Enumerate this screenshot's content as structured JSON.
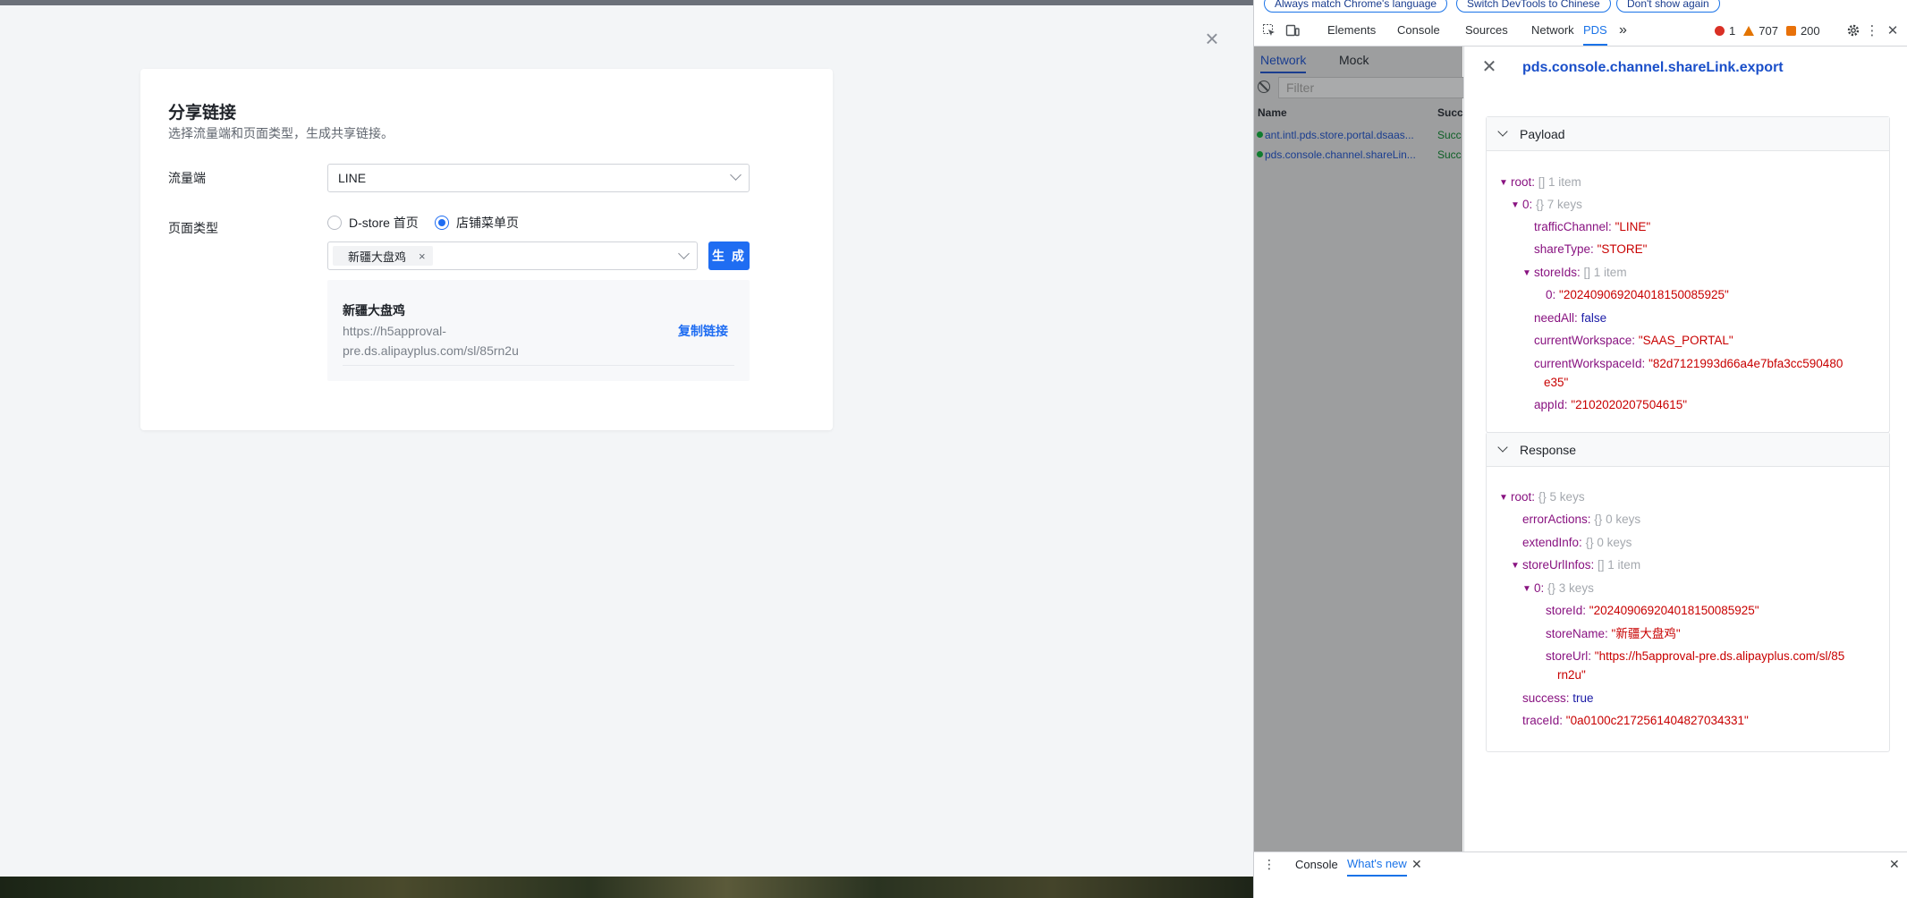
{
  "modal": {
    "title": "分享链接",
    "subtitle": "选择流量端和页面类型，生成共享链接。",
    "traffic_label": "流量端",
    "traffic_value": "LINE",
    "page_type_label": "页面类型",
    "page_type_options": [
      "D-store 首页",
      "店铺菜单页"
    ],
    "page_type_selected": "店铺菜单页",
    "store_tag": "新疆大盘鸡",
    "generate_button": "生 成",
    "result": {
      "store_name": "新疆大盘鸡",
      "url": "https://h5approval-pre.ds.alipayplus.com/sl/85rn2u",
      "copy_button": "复制链接"
    }
  },
  "devtools": {
    "banner_buttons": [
      "Always match Chrome's language",
      "Switch DevTools to Chinese",
      "Don't show again"
    ],
    "tabs": [
      "Elements",
      "Console",
      "Sources",
      "Network",
      "PDS"
    ],
    "active_tab": "PDS",
    "more_tabs": "»",
    "counts": {
      "errors": "1",
      "warnings": "707",
      "info": "200"
    },
    "network_subtabs": [
      "Network",
      "Mock"
    ],
    "filter_placeholder": "Filter",
    "table_headers": {
      "name": "Name",
      "status": "Succ"
    },
    "requests": [
      {
        "name": "ant.intl.pds.store.portal.dsaas...",
        "status": "Succ"
      },
      {
        "name": "pds.console.channel.shareLin...",
        "status": "Succ"
      }
    ],
    "detail": {
      "title": "pds.console.channel.shareLink.export",
      "payload_label": "Payload",
      "response_label": "Response"
    },
    "payload": {
      "root_key": "root:",
      "root_meta": "[]  1 item",
      "item0_key": "0:",
      "item0_meta": "{}  7 keys",
      "trafficChannel_key": "trafficChannel:",
      "trafficChannel": "\"LINE\"",
      "shareType_key": "shareType:",
      "shareType": "\"STORE\"",
      "storeIds_key": "storeIds:",
      "storeIds_meta": "[]  1 item",
      "storeIds0_key": "0:",
      "storeIds0": "\"2024090692040181500859​25\"",
      "needAll_key": "needAll:",
      "needAll": "false",
      "currentWorkspace_key": "currentWorkspace:",
      "currentWorkspace": "\"SAAS_PORTAL\"",
      "currentWorkspaceId_key": "currentWorkspaceId:",
      "currentWorkspaceId_1": "\"82d7121993d66a4e7bfa3cc590480",
      "currentWorkspaceId_2": "e35\"",
      "appId_key": "appId:",
      "appId": "\"2102020207504615\""
    },
    "response": {
      "root_key": "root:",
      "root_meta": "{}  5 keys",
      "errorActions_key": "errorActions:",
      "errorActions_meta": "{}  0 keys",
      "extendInfo_key": "extendInfo:",
      "extendInfo_meta": "{}  0 keys",
      "storeUrlInfos_key": "storeUrlInfos:",
      "storeUrlInfos_meta": "[]  1 item",
      "item0_key": "0:",
      "item0_meta": "{}  3 keys",
      "storeId_key": "storeId:",
      "storeId": "\"2024090692040181500859​25\"",
      "storeName_key": "storeName:",
      "storeName": "\"新疆大盘鸡\"",
      "storeUrl_key": "storeUrl:",
      "storeUrl_1": "\"https://h5approval-pre.ds.alipayplus.com/sl/85",
      "storeUrl_2": "rn2u\"",
      "success_key": "success:",
      "success": "true",
      "traceId_key": "traceId:",
      "traceId": "\"0a0100c2172561404827034331\""
    },
    "drawer": {
      "console_tab": "Console",
      "whats_new_tab": "What's new"
    }
  }
}
